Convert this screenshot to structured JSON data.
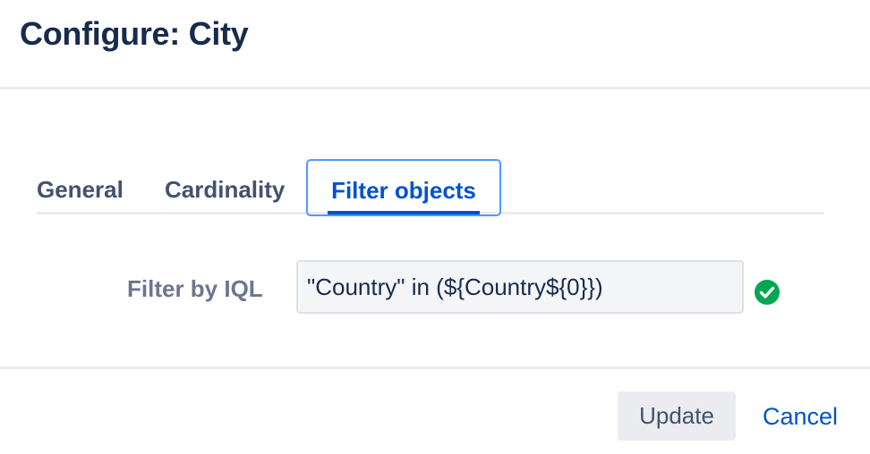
{
  "dialog": {
    "title": "Configure: City"
  },
  "tabs": [
    {
      "label": "General",
      "active": false
    },
    {
      "label": "Cardinality",
      "active": false
    },
    {
      "label": "Filter objects",
      "active": true
    }
  ],
  "filter": {
    "label": "Filter by IQL",
    "value": "\"Country\" in (${Country${0}})",
    "status_icon": "check-circle-icon",
    "status_color": "#00a651"
  },
  "footer": {
    "update_label": "Update",
    "cancel_label": "Cancel"
  },
  "colors": {
    "accent": "#0052cc",
    "focus_ring": "#4c9aff",
    "title": "#172b4d"
  }
}
